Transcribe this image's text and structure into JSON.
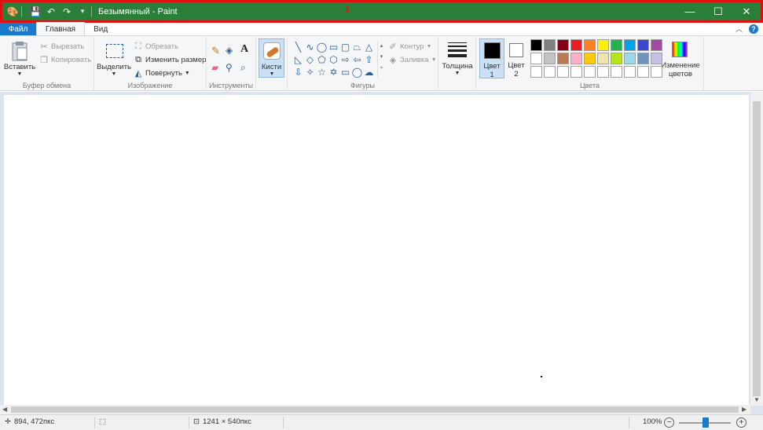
{
  "window": {
    "title": "Безымянный - Paint",
    "marker": "1"
  },
  "tabs": {
    "file": "Файл",
    "home": "Главная",
    "view": "Вид"
  },
  "ribbon": {
    "clipboard": {
      "paste": "Вставить",
      "cut": "Вырезать",
      "copy": "Копировать",
      "label": "Буфер обмена"
    },
    "image": {
      "select": "Выделить",
      "crop": "Обрезать",
      "resize": "Изменить размер",
      "rotate": "Повернуть",
      "label": "Изображение"
    },
    "tools": {
      "label": "Инструменты"
    },
    "brushes": {
      "label": "Кисти"
    },
    "shapes": {
      "outline": "Контур",
      "fill": "Заливка",
      "label": "Фигуры"
    },
    "size": {
      "label": "Толщина"
    },
    "colors": {
      "color1": "Цвет 1",
      "color2": "Цвет 2",
      "edit": "Изменение цветов",
      "label": "Цвета",
      "palette": [
        "#000000",
        "#7f7f7f",
        "#880015",
        "#ed1c24",
        "#ff7f27",
        "#fff200",
        "#22b14c",
        "#00a2e8",
        "#3f48cc",
        "#a349a4",
        "#ffffff",
        "#c3c3c3",
        "#b97a57",
        "#ffaec9",
        "#ffc90e",
        "#efe4b0",
        "#b5e61d",
        "#99d9ea",
        "#7092be",
        "#c8bfe7",
        "#ffffff",
        "#ffffff",
        "#ffffff",
        "#ffffff",
        "#ffffff",
        "#ffffff",
        "#ffffff",
        "#ffffff",
        "#ffffff",
        "#ffffff"
      ]
    }
  },
  "status": {
    "cursor": "894, 472пкс",
    "canvas_size": "1241 × 540пкс",
    "zoom": "100%"
  }
}
